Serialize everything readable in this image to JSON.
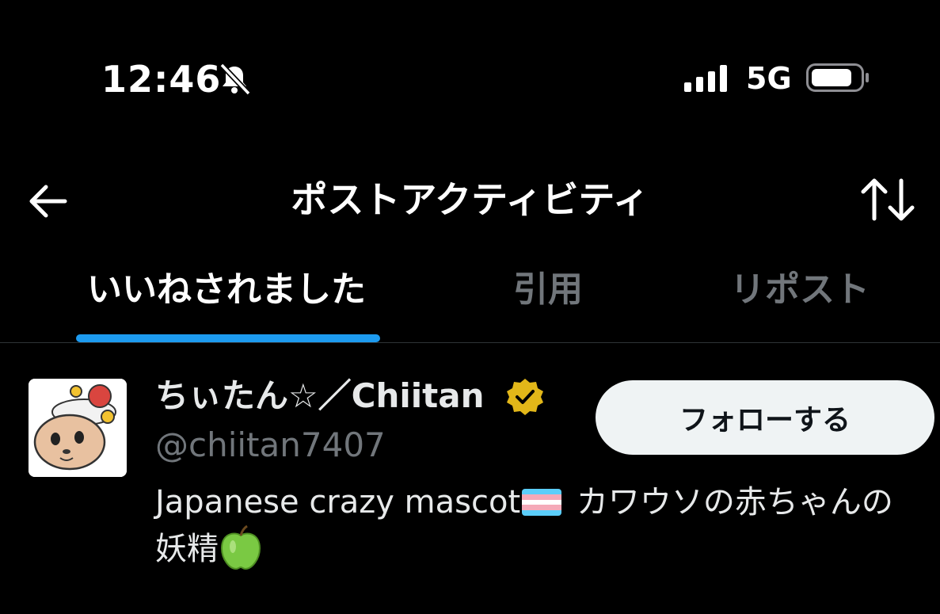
{
  "status_bar": {
    "time": "12:46",
    "network": "5G",
    "icons": [
      "bell-slash-icon",
      "signal-icon",
      "battery-icon"
    ]
  },
  "nav": {
    "title": "ポストアクティビティ",
    "back_icon": "arrow-left-icon",
    "sort_icon": "sort-arrows-icon"
  },
  "tabs": [
    {
      "label": "いいねされました",
      "active": true
    },
    {
      "label": "引用",
      "active": false
    },
    {
      "label": "リポスト",
      "active": false
    }
  ],
  "user": {
    "display_name": "ちぃたん☆／Chiitan",
    "handle": "@chiitan7407",
    "follow_label": "フォローする",
    "bio_text_1": "Japanese crazy mascot",
    "bio_text_2": " カワウソの赤ちゃんの妖精",
    "verified_color": "#e2b719"
  },
  "colors": {
    "accent": "#1d9bf0",
    "background": "#000000",
    "muted": "#71767b"
  }
}
